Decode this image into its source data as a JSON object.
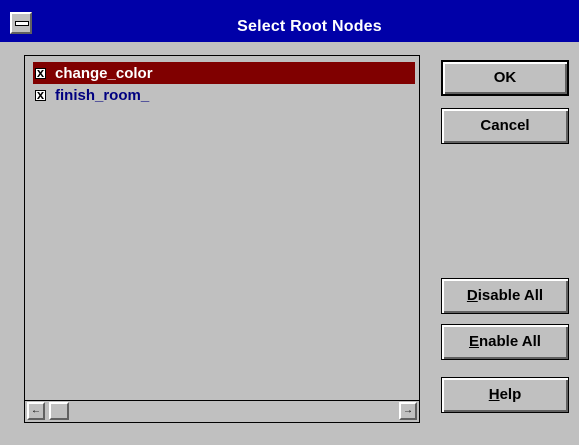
{
  "window": {
    "title": "Select Root Nodes"
  },
  "list": {
    "items": [
      {
        "label": "change_color",
        "checked": true,
        "selected": true,
        "check_glyph": "x"
      },
      {
        "label": "finish_room_",
        "checked": true,
        "selected": false,
        "check_glyph": "x"
      }
    ]
  },
  "scrollbar": {
    "left_arrow": "←",
    "right_arrow": "→"
  },
  "buttons": {
    "ok": {
      "label": "OK"
    },
    "cancel": {
      "label": "Cancel"
    },
    "disable_all": {
      "mnemonic": "D",
      "rest": "isable All"
    },
    "enable_all": {
      "mnemonic": "E",
      "rest": "nable All"
    },
    "help": {
      "mnemonic": "H",
      "rest": "elp"
    }
  },
  "colors": {
    "title_bar": "#0000a8",
    "selection": "#800000",
    "item_text": "#000080",
    "face": "#c0c0c0"
  }
}
